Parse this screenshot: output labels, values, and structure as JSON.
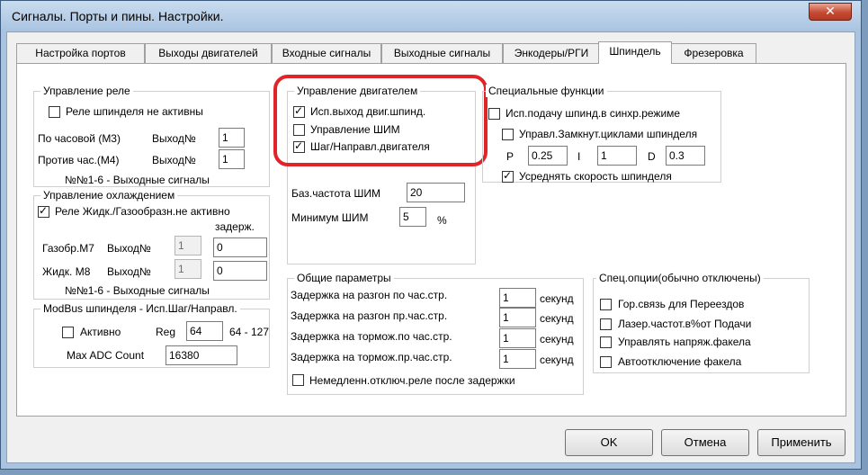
{
  "window": {
    "title": "Сигналы. Порты и пины. Настройки."
  },
  "tabs": [
    "Настройка портов",
    "Выходы двигателей",
    "Входные сигналы",
    "Выходные сигналы",
    "Энкодеры/РГИ",
    "Шпиндель",
    "Фрезеровка"
  ],
  "relay": {
    "title": "Управление реле",
    "spindle_inactive": "Реле шпинделя не активны",
    "cw_label": "По часовой (М3)",
    "cw_out_label": "Выход№",
    "cw_out_value": "1",
    "ccw_label": "Против час.(М4)",
    "ccw_out_label": "Выход№",
    "ccw_out_value": "1",
    "note": "№№1-6 - Выходные сигналы"
  },
  "cooling": {
    "title": "Управление охлаждением",
    "inactive": "Реле Жидк./Газообразн.не активно",
    "delay_header": "задерж.",
    "gas_label": "Газобр.М7",
    "gas_out_label": "Выход№",
    "gas_out_value": "1",
    "gas_delay": "0",
    "liquid_label": "Жидк. М8",
    "liquid_out_label": "Выход№",
    "liquid_out_value": "1",
    "liquid_delay": "0",
    "note": "№№1-6 - Выходные сигналы"
  },
  "modbus": {
    "title": "ModBus шпинделя - Исп.Шаг/Направл.",
    "active": "Активно",
    "reg_label": "Reg",
    "reg_value": "64",
    "reg_range": "64 - 127",
    "max_adc_label": "Max ADC Count",
    "max_adc_value": "16380"
  },
  "motor": {
    "title": "Управление двигателем",
    "use_motor_output": "Исп.выход двиг.шпинд.",
    "pwm_control": "Управление ШИМ",
    "step_dir": "Шаг/Направл.двигателя",
    "base_freq_label": "Баз.частота ШИМ",
    "base_freq_value": "20",
    "min_pwm_label": "Минимум ШИМ",
    "min_pwm_value": "5",
    "min_pwm_unit": "%"
  },
  "special": {
    "title": "Специальные функции",
    "sync_mode": "Исп.подачу шпинд.в синхр.режиме",
    "closed_loop": "Управл.Замкнут.циклами шпинделя",
    "p_label": "P",
    "p_value": "0.25",
    "i_label": "I",
    "i_value": "1",
    "d_label": "D",
    "d_value": "0.3",
    "average_speed": "Усреднять скорость шпинделя"
  },
  "general": {
    "title": "Общие параметры",
    "rows": [
      {
        "label": "Задержка на разгон по час.стр.",
        "value": "1",
        "unit": "секунд"
      },
      {
        "label": "Задержка на разгон пр.час.стр.",
        "value": "1",
        "unit": "секунд"
      },
      {
        "label": "Задержка на тормож.по час.стр.",
        "value": "1",
        "unit": "секунд"
      },
      {
        "label": "Задержка на тормож.пр.час.стр.",
        "value": "1",
        "unit": "секунд"
      }
    ],
    "immediate_off": "Немедленн.отключ.реле после задержки"
  },
  "options": {
    "title": "Спец.опции(обычно отключены)",
    "items": [
      "Гор.связь для Переездов",
      "Лазер.частот.в%от Подачи",
      "Управлять напряж.факела",
      "Автоотключение факела"
    ]
  },
  "buttons": {
    "ok": "OK",
    "cancel": "Отмена",
    "apply": "Применить"
  },
  "colors": {
    "highlight": "#e0242a",
    "close_button": "#c74a33",
    "frame": "#a9c3e0"
  }
}
